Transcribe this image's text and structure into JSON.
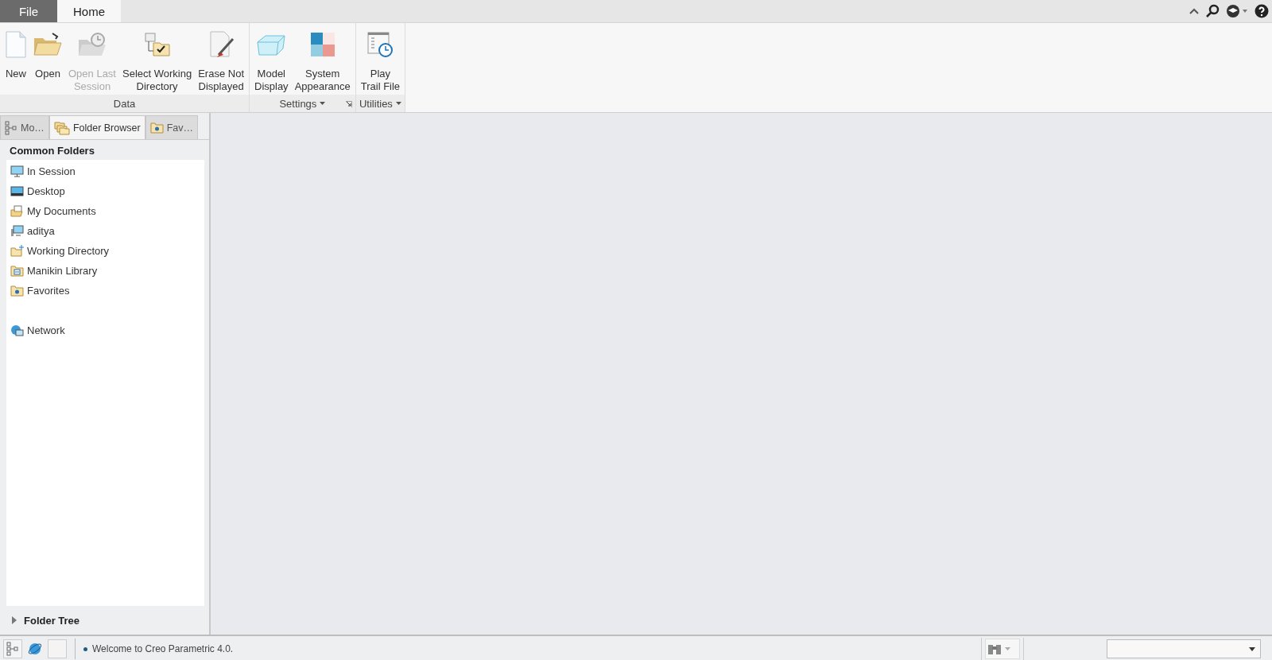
{
  "ribbon_tabs": [
    {
      "label": "File",
      "selected": false,
      "kind": "file"
    },
    {
      "label": "Home",
      "selected": true,
      "kind": "tab"
    }
  ],
  "ribbon_groups": [
    {
      "label": "Data",
      "dropdown": false,
      "launcher": false,
      "commands": [
        {
          "label": "New",
          "disabled": false
        },
        {
          "label": "Open",
          "disabled": false
        },
        {
          "label": "Open Last\nSession",
          "disabled": true
        },
        {
          "label": "Select Working\nDirectory",
          "disabled": false
        },
        {
          "label": "Erase Not\nDisplayed",
          "disabled": false
        }
      ]
    },
    {
      "label": "Settings",
      "dropdown": true,
      "launcher": true,
      "commands": [
        {
          "label": "Model\nDisplay",
          "disabled": false
        },
        {
          "label": "System\nAppearance",
          "disabled": false
        }
      ]
    },
    {
      "label": "Utilities",
      "dropdown": true,
      "launcher": false,
      "commands": [
        {
          "label": "Play\nTrail File",
          "disabled": false
        }
      ]
    }
  ],
  "panel_tabs": [
    {
      "label": "Mo…",
      "selected": false
    },
    {
      "label": "Folder Browser",
      "selected": true
    },
    {
      "label": "Fav…",
      "selected": false
    }
  ],
  "common_folders": {
    "title": "Common Folders",
    "items": [
      {
        "label": "In Session"
      },
      {
        "label": "Desktop"
      },
      {
        "label": "My Documents"
      },
      {
        "label": "aditya"
      },
      {
        "label": "Working Directory"
      },
      {
        "label": "Manikin Library"
      },
      {
        "label": "Favorites"
      }
    ],
    "network_items": [
      {
        "label": "Network"
      }
    ]
  },
  "folder_tree": {
    "label": "Folder Tree",
    "expanded": false
  },
  "status_bar": {
    "message": "Welcome to Creo Parametric 4.0."
  }
}
